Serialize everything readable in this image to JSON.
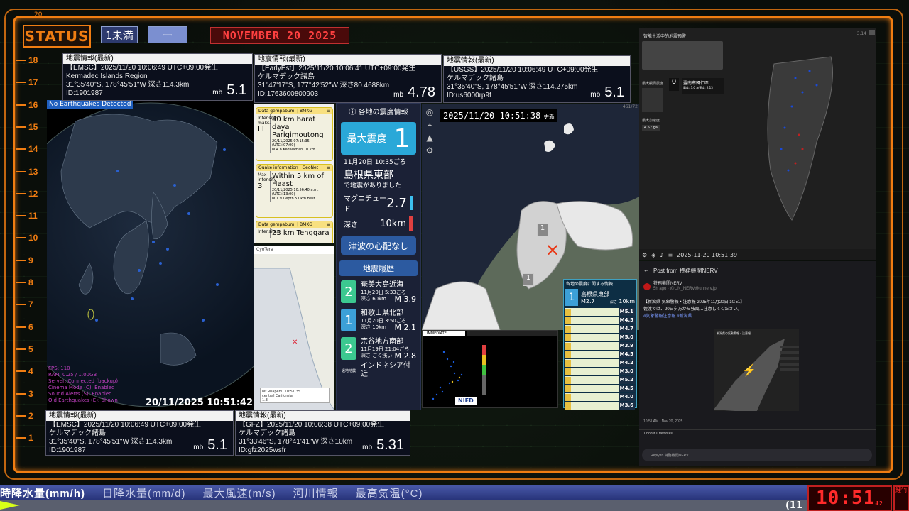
{
  "status": {
    "label": "STATUS",
    "pill_a": "1未満",
    "pill_b": "ー",
    "date_banner": "NOVEMBER 20 2025"
  },
  "ruler": [
    "18",
    "17",
    "16",
    "15",
    "14",
    "13",
    "12",
    "11",
    "10",
    "9",
    "8",
    "7",
    "6",
    "5",
    "4",
    "3",
    "2",
    "1"
  ],
  "ruler_top": "20",
  "panels": {
    "emsc_top": {
      "head": "地震情報(最新)",
      "l1": "【EMSC】2025/11/20  10:06:49  UTC+09:00発生",
      "l2": "Kermadec Islands Region",
      "l3": "31°35'40\"S,  178°45'51\"W   深さ114.3km",
      "l4": "ID:1901987",
      "mb": "mb",
      "mag": "5.1"
    },
    "earlyest": {
      "head": "地震情報(最新)",
      "l1": "【EarlyEst】2025/11/20  10:06:41  UTC+09:00発生",
      "l2": "ケルマデック諸島",
      "l3": "31°47'17\"S,  177°42'52\"W   深さ80.4688km",
      "l4": "ID:1763600800903",
      "mb": "mb",
      "mag": "4.78"
    },
    "usgs": {
      "head": "地震情報(最新)",
      "l1": "【USGS】2025/11/20  10:06:49  UTC+09:00発生",
      "l2": "ケルマデック諸島",
      "l3": "31°35'40\"S,  178°45'51\"W   深さ114.275km",
      "l4": "ID:us6000rp9f",
      "mb": "mb",
      "mag": "5.1"
    },
    "emsc_bottom": {
      "head": "地震情報(最新)",
      "l1": "【EMSC】2025/11/20  10:06:49  UTC+09:00発生",
      "l2": "ケルマデック諸島",
      "l3": "31°35'40\"S,  178°45'51\"W   深さ114.3km",
      "l4": "ID:1901987",
      "mb": "mb",
      "mag": "5.1"
    },
    "gfz": {
      "head": "地震情報(最新)",
      "l1": "【GFZ】2025/11/20  10:06:38  UTC+09:00発生",
      "l2": "ケルマデック諸島",
      "l3": "31°33'46\"S,  178°41'41\"W   深さ10km",
      "l4": "ID:gfz2025wsfr",
      "mb": "mb",
      "mag": "5.31"
    }
  },
  "globe": {
    "banner": "No Earthquakes Detected",
    "stats": [
      "FPS: 110",
      "RAM: 0.25 / 1.00GB",
      "Server: Connected (backup)",
      "Cinema Mode (C): Enabled",
      "Sound Alerts (S): Enabled",
      "Old Earthquakes (E): Shown"
    ],
    "time": "20/11/2025 10:51:42"
  },
  "feed": {
    "c1": {
      "head": "Data gempabumi | BMKG",
      "left": "Intensitas maks.",
      "title": "40 km barat daya Parigimoutong",
      "meta": "20/11/2025 07:15:35 (UTC+07:00)",
      "sub": "M 4.8   Kedalaman 10 km"
    },
    "c2": {
      "head": "Quake information | GeoNet",
      "left": "Max intensity",
      "title": "Within 5 km of Haast",
      "meta": "20/11/2025 10:56:40 a.m. (UTC+13:00)",
      "sub": "M 1.9   Depth 5.0km   Best"
    },
    "c3": {
      "head": "Data gempabumi | BMKG",
      "left": "Intensitas",
      "title": "23 km Tenggara"
    }
  },
  "camap": {
    "label": "CyoTera",
    "caption1": "Mt Ruapehu 10:51:35",
    "caption2": "central California",
    "mag": "1.3"
  },
  "jpinfo": {
    "title": "各地の震度情報",
    "max_label": "最大震度",
    "max_val": "1",
    "date": "11月20日 10:35ごろ",
    "place": "島根県東部",
    "note": "で地震がありました",
    "mag_label": "マグニチュード",
    "mag": "2.7",
    "depth_label": "深さ",
    "depth": "10km",
    "tsunami": "津波の心配なし",
    "history_title": "地震履歴",
    "history": [
      {
        "int": "2",
        "place": "奄美大島近海",
        "time": "11月20日 5:33ごろ",
        "depth": "深さ 60km",
        "mag": "M 3.9",
        "box": "最大震度"
      },
      {
        "int": "1",
        "place": "和歌山県北部",
        "time": "11月20日 3:50ごろ",
        "depth": "深さ 10km",
        "mag": "M 2.1",
        "box": "最大震度"
      },
      {
        "int": "2",
        "place": "宗谷地方南部",
        "time": "11月19日 21:04ごろ",
        "depth": "深さ ごく浅い",
        "mag": "M 2.8",
        "box": "最大震度"
      }
    ],
    "last": "インドネシア付近",
    "last_box": "遠地地震"
  },
  "tools": [
    "◎",
    "⌁",
    "▲",
    "⚙"
  ],
  "jpmap": {
    "time": "2025/11/20  10:51:38",
    "time_suffix": "更新",
    "mark1": "1",
    "mark2": "1",
    "corner": "461/72"
  },
  "shindo": {
    "title": "各地の震度に関する情報",
    "int": "1",
    "place": "島根県東部",
    "mag": "M2.7",
    "depth_label": "深さ",
    "depth": "10km",
    "rows": [
      "M5.1",
      "M4.5",
      "M4.7",
      "M5.0",
      "M3.9",
      "M4.5",
      "M4.2",
      "M3.0",
      "M5.2",
      "M4.5",
      "M4.0",
      "M3.6"
    ]
  },
  "nied": {
    "logo": "NIED",
    "chip": "IMMEDIATE"
  },
  "taiwan": {
    "title": "智能生活中的地震預警",
    "corner": "3.14",
    "label1": "最大觀測震度",
    "val1": "0",
    "place": "臺南市歸仁區",
    "detail": "震度: 3.0   加速度: 2.13",
    "label2": "最大加速度",
    "accel": "4.57 gal",
    "time": "2025-11-20 10:51:39"
  },
  "nerv": {
    "header": "Post from 特務機関NERV",
    "name": "特務機関NERV",
    "handle": "5h ago · @UN_NERV@unnerv.jp",
    "body1": "【新潟県 気象警報・注意報 2025年11月20日 10:51】",
    "body2": "佐渡では、20日夕方から強風に注意してください。",
    "tags": "#気象警報注意報 #新潟県",
    "img_title": "新潟県の気象警報・注意報",
    "meta": "10:51 AM · Nov 20, 2025",
    "boosts": "1 boost   0 favorites",
    "reply": "Reply to 特務機関NERV"
  },
  "ticker": {
    "items": [
      "時降水量(mm/h)",
      "日降水量(mm/d)",
      "最大風速(m/s)",
      "河川情報",
      "最高気温(°C)"
    ],
    "num": "(11"
  },
  "clock": {
    "time": "10:51",
    "suffix": "42"
  },
  "corner": "鯉竹"
}
